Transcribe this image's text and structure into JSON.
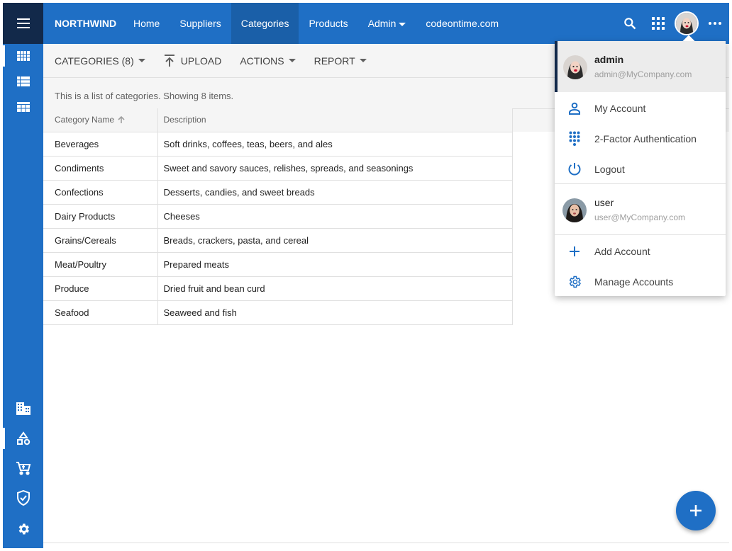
{
  "appbar": {
    "brand": "NORTHWIND",
    "nav": [
      {
        "label": "Home",
        "active": false
      },
      {
        "label": "Suppliers",
        "active": false
      },
      {
        "label": "Categories",
        "active": true
      },
      {
        "label": "Products",
        "active": false
      },
      {
        "label": "Admin",
        "active": false,
        "dropdown": true
      },
      {
        "label": "codeontime.com",
        "active": false
      }
    ],
    "icons": [
      "search-icon",
      "apps-icon",
      "avatar",
      "more-icon"
    ]
  },
  "sidebar": {
    "icons": [
      "categories-grid-icon",
      "list-icon",
      "table-icon",
      "suppliers-icon",
      "shapes-icon",
      "cart-icon",
      "shield-icon",
      "gear-icon"
    ]
  },
  "toolbar": {
    "categories": "CATEGORIES (8)",
    "upload": "UPLOAD",
    "actions": "ACTIONS",
    "report": "REPORT"
  },
  "info": "This is a list of categories. Showing 8 items.",
  "grid": {
    "columns": [
      "Category Name",
      "Description"
    ],
    "rows": [
      [
        "Beverages",
        "Soft drinks, coffees, teas, beers, and ales"
      ],
      [
        "Condiments",
        "Sweet and savory sauces, relishes, spreads, and seasonings"
      ],
      [
        "Confections",
        "Desserts, candies, and sweet breads"
      ],
      [
        "Dairy Products",
        "Cheeses"
      ],
      [
        "Grains/Cereals",
        "Breads, crackers, pasta, and cereal"
      ],
      [
        "Meat/Poultry",
        "Prepared meats"
      ],
      [
        "Produce",
        "Dried fruit and bean curd"
      ],
      [
        "Seafood",
        "Seaweed and fish"
      ]
    ]
  },
  "account_menu": {
    "current": {
      "name": "admin",
      "email": "admin@MyCompany.com"
    },
    "items": [
      {
        "label": "My Account",
        "icon": "person-icon"
      },
      {
        "label": "2-Factor Authentication",
        "icon": "dialpad-icon"
      },
      {
        "label": "Logout",
        "icon": "power-icon"
      }
    ],
    "other": {
      "name": "user",
      "email": "user@MyCompany.com"
    },
    "manage": [
      {
        "label": "Add Account",
        "icon": "plus-icon"
      },
      {
        "label": "Manage Accounts",
        "icon": "gear-icon"
      }
    ]
  },
  "colors": {
    "primary": "#1f6fc5",
    "dark": "#12294a",
    "toolbar_bg": "#f5f5f5"
  }
}
